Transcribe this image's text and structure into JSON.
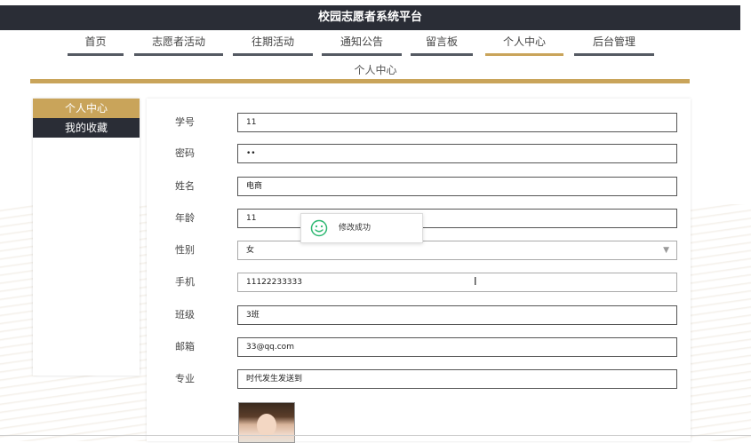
{
  "app": {
    "title": "校园志愿者系统平台"
  },
  "nav": {
    "items": [
      {
        "label": "首页"
      },
      {
        "label": "志愿者活动"
      },
      {
        "label": "往期活动"
      },
      {
        "label": "通知公告"
      },
      {
        "label": "留言板"
      },
      {
        "label": "个人中心",
        "active": true
      },
      {
        "label": "后台管理"
      }
    ]
  },
  "page": {
    "subtitle": "个人中心"
  },
  "sidebar": {
    "items": [
      {
        "label": "个人中心"
      },
      {
        "label": "我的收藏"
      }
    ]
  },
  "form": {
    "fields": [
      {
        "label": "学号",
        "value": "11"
      },
      {
        "label": "密码",
        "value": "••"
      },
      {
        "label": "姓名",
        "value": "电商"
      },
      {
        "label": "年龄",
        "value": "11"
      },
      {
        "label": "性别",
        "value": "女",
        "type": "select"
      },
      {
        "label": "手机",
        "value": "11122233333"
      },
      {
        "label": "班级",
        "value": "3班"
      },
      {
        "label": "邮箱",
        "value": "33@qq.com"
      },
      {
        "label": "专业",
        "value": "时代发生发送到"
      }
    ]
  },
  "toast": {
    "message": "修改成功",
    "icon": "smile-icon",
    "color": "#2eb872"
  },
  "colors": {
    "accent": "#c9a45a",
    "dark": "#2a2d36"
  }
}
